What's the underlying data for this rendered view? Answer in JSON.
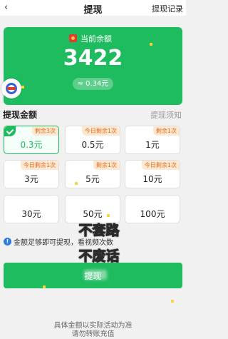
{
  "header": {
    "back_icon": "chevron-left-icon",
    "title": "提现",
    "records_label": "提现记录"
  },
  "balance_card": {
    "label": "当前余额",
    "amount": "3422",
    "equivalent": "≈ 0.34元",
    "accent_color": "#1fbb5f"
  },
  "amount_section": {
    "title": "提现金额",
    "notice_link": "提现须知",
    "options": [
      {
        "value": "0.3元",
        "tag": "剩余3次",
        "selected": true
      },
      {
        "value": "0.5元",
        "tag": "今日剩余1次",
        "selected": false
      },
      {
        "value": "1元",
        "tag": "剩余1次",
        "selected": false
      },
      {
        "value": "3元",
        "tag": "今日剩余1次",
        "selected": false
      },
      {
        "value": "5元",
        "tag": "剩余1次",
        "selected": false
      },
      {
        "value": "10元",
        "tag": "今日剩余1次",
        "selected": false
      },
      {
        "value": "30元",
        "tag": "",
        "selected": false
      },
      {
        "value": "50元",
        "tag": "",
        "selected": false
      },
      {
        "value": "100元",
        "tag": "",
        "selected": false
      }
    ]
  },
  "tip": {
    "icon": "info-icon",
    "text": "金额足够即可提现，看视频次数"
  },
  "overlay_text": {
    "line1": "不套路",
    "line2": "不废话"
  },
  "withdraw_button": {
    "label": "提现"
  },
  "footer": {
    "line1": "具体金额以实际活动为准",
    "line2": "请勿转账充值"
  }
}
